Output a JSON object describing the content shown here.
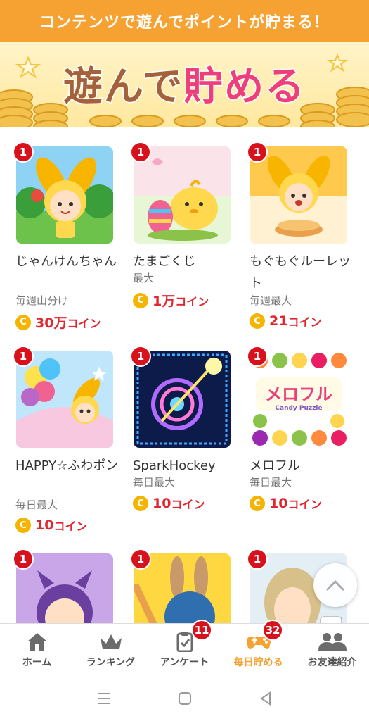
{
  "banner": {
    "text": "コンテンツで遊んでポイントが貯まる！"
  },
  "hero": {
    "title_part1": "遊んで",
    "title_part2": "貯める"
  },
  "games": [
    {
      "badge": "1",
      "name": "じゃんけんちゃん",
      "sub": "毎週山分け",
      "coin_symbol": "C",
      "reward_value": "30万",
      "reward_unit": "コイン"
    },
    {
      "badge": "1",
      "name": "たまごくじ",
      "sub": "最大",
      "coin_symbol": "C",
      "reward_value": "1万",
      "reward_unit": "コイン"
    },
    {
      "badge": "1",
      "name": "もぐもぐルーレット",
      "sub": "毎週最大",
      "coin_symbol": "C",
      "reward_value": "21",
      "reward_unit": "コイン"
    },
    {
      "badge": "1",
      "name": "HAPPY☆ふわポン",
      "sub": "毎日最大",
      "coin_symbol": "C",
      "reward_value": "10",
      "reward_unit": "コイン"
    },
    {
      "badge": "1",
      "name": "SparkHockey",
      "sub": "毎日最大",
      "coin_symbol": "C",
      "reward_value": "10",
      "reward_unit": "コイン"
    },
    {
      "badge": "1",
      "name": "メロフル",
      "sub": "毎日最大",
      "coin_symbol": "C",
      "reward_value": "10",
      "reward_unit": "コイン"
    },
    {
      "badge": "1"
    },
    {
      "badge": "1"
    },
    {
      "badge": "1"
    }
  ],
  "thumb_text": {
    "melofull_logo": "メロフル",
    "melofull_sub": "Candy Puzzle"
  },
  "tabs": [
    {
      "label": "ホーム",
      "icon": "home-icon"
    },
    {
      "label": "ランキング",
      "icon": "crown-icon"
    },
    {
      "label": "アンケート",
      "icon": "clipboard-icon",
      "badge": "11"
    },
    {
      "label": "毎日貯める",
      "icon": "gamepad-icon",
      "badge": "32",
      "active": true
    },
    {
      "label": "お友達紹介",
      "icon": "friends-icon"
    }
  ],
  "colors": {
    "brand_orange": "#f5a233",
    "badge_red": "#d8121c",
    "reward_red": "#e0262f",
    "coin_gold": "#f4b400"
  }
}
